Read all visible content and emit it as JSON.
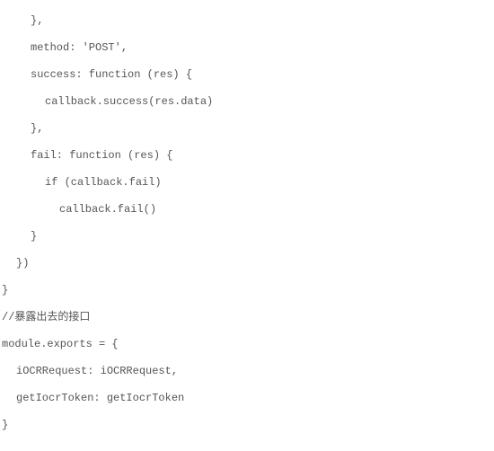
{
  "code": {
    "lines": [
      {
        "indent": 2,
        "text": "},"
      },
      {
        "indent": 2,
        "text": "method: 'POST',"
      },
      {
        "indent": 2,
        "text": "success: function (res) {"
      },
      {
        "indent": 3,
        "text": "callback.success(res.data)"
      },
      {
        "indent": 2,
        "text": "},"
      },
      {
        "indent": 2,
        "text": "fail: function (res) {"
      },
      {
        "indent": 3,
        "text": "if (callback.fail)"
      },
      {
        "indent": 4,
        "text": "callback.fail()"
      },
      {
        "indent": 2,
        "text": "}"
      },
      {
        "indent": 1,
        "text": "})"
      },
      {
        "indent": 0,
        "text": "}"
      },
      {
        "indent": 0,
        "text": "//暴露出去的接口"
      },
      {
        "indent": 0,
        "text": "module.exports = {"
      },
      {
        "indent": 1,
        "text": "iOCRRequest: iOCRRequest,"
      },
      {
        "indent": 1,
        "text": "getIocrToken: getIocrToken"
      },
      {
        "indent": 0,
        "text": "}"
      }
    ]
  }
}
